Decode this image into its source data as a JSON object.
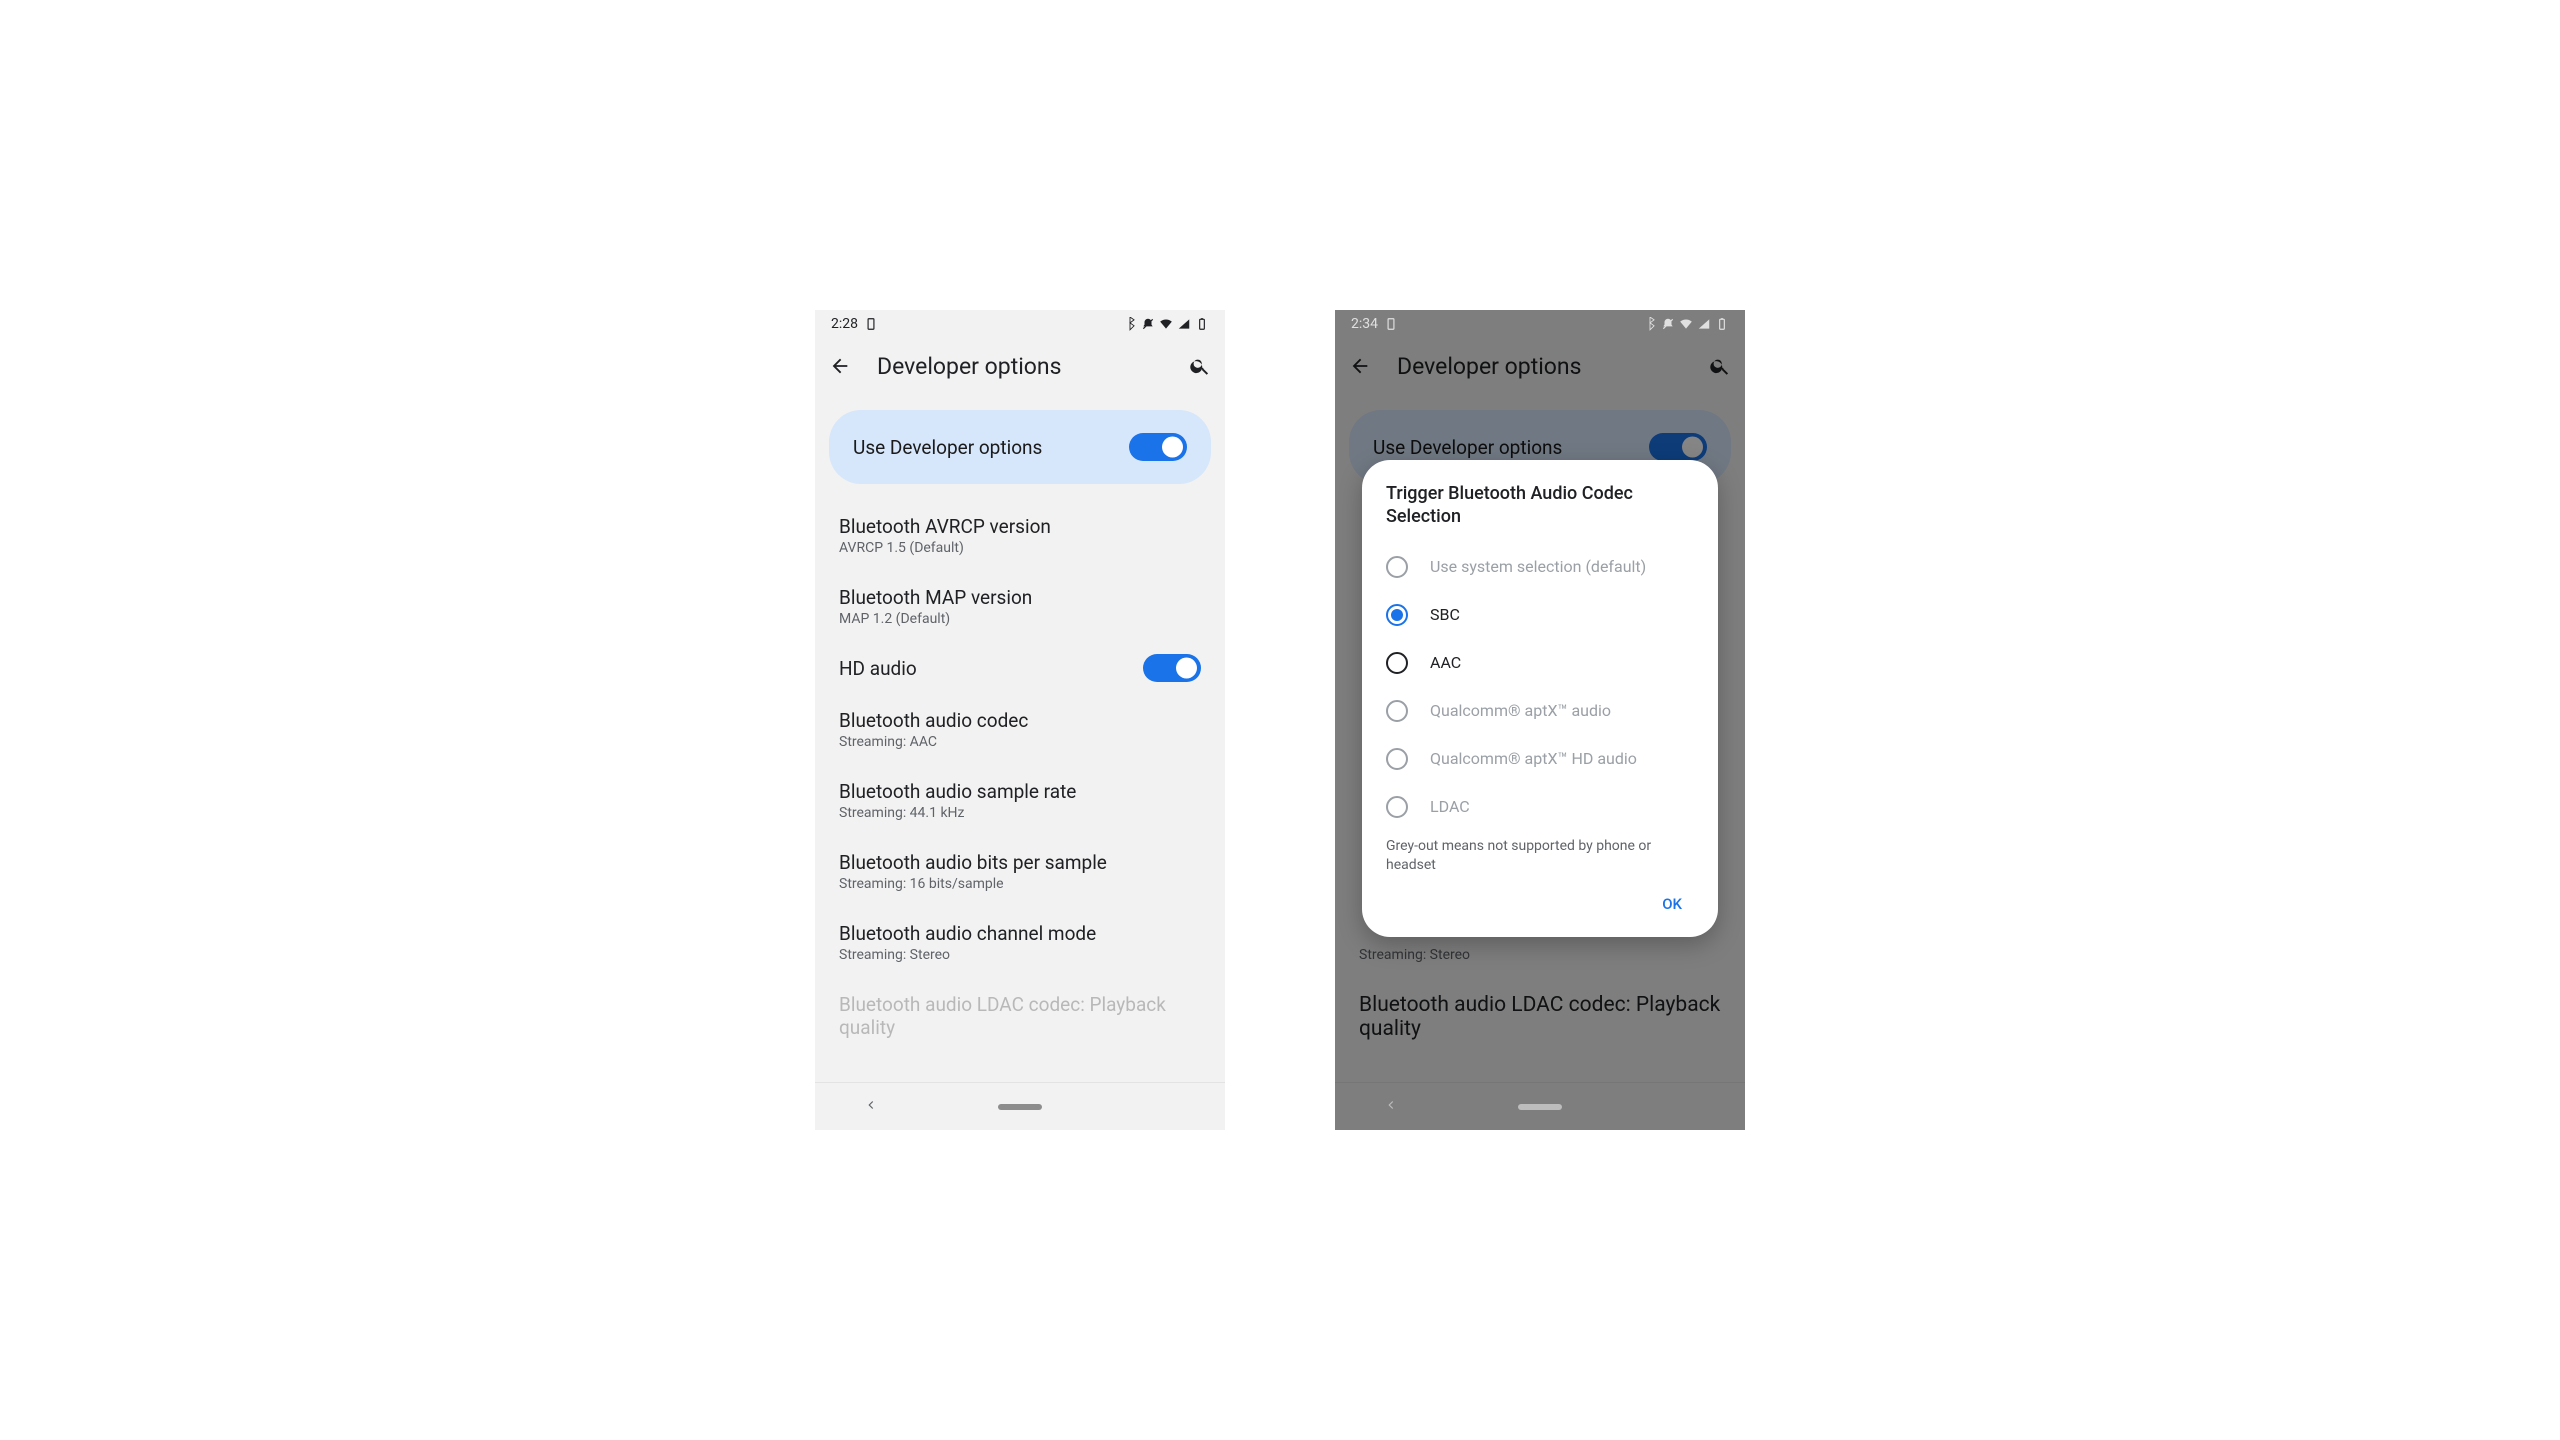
{
  "left": {
    "status": {
      "time": "2:28"
    },
    "toolbar_title": "Developer options",
    "use_dev_label": "Use Developer options",
    "settings": {
      "avrcp": {
        "title": "Bluetooth AVRCP version",
        "sub": "AVRCP 1.5 (Default)"
      },
      "map": {
        "title": "Bluetooth MAP version",
        "sub": "MAP 1.2 (Default)"
      },
      "hd": {
        "title": "HD audio"
      },
      "codec": {
        "title": "Bluetooth audio codec",
        "sub": "Streaming: AAC"
      },
      "sample": {
        "title": "Bluetooth audio sample rate",
        "sub": "Streaming: 44.1 kHz"
      },
      "bits": {
        "title": "Bluetooth audio bits per sample",
        "sub": "Streaming: 16 bits/sample"
      },
      "chan": {
        "title": "Bluetooth audio channel mode",
        "sub": "Streaming: Stereo"
      },
      "ldac": {
        "title": "Bluetooth audio LDAC codec: Playback quality"
      }
    }
  },
  "right": {
    "status": {
      "time": "2:34"
    },
    "toolbar_title": "Developer options",
    "use_dev_label": "Use Developer options",
    "dialog": {
      "title": "Trigger Bluetooth Audio Codec Selection",
      "options": {
        "default": "Use system selection (default)",
        "sbc": "SBC",
        "aac": "AAC",
        "aptx": "Qualcomm® aptX™ audio",
        "aptxhd": "Qualcomm® aptX™ HD audio",
        "ldac": "LDAC"
      },
      "footnote": "Grey-out means not supported by phone or headset",
      "ok": "OK"
    },
    "bg": {
      "chan_sub": "Streaming: Stereo",
      "ldac_title": "Bluetooth audio LDAC codec: Playback quality"
    }
  }
}
